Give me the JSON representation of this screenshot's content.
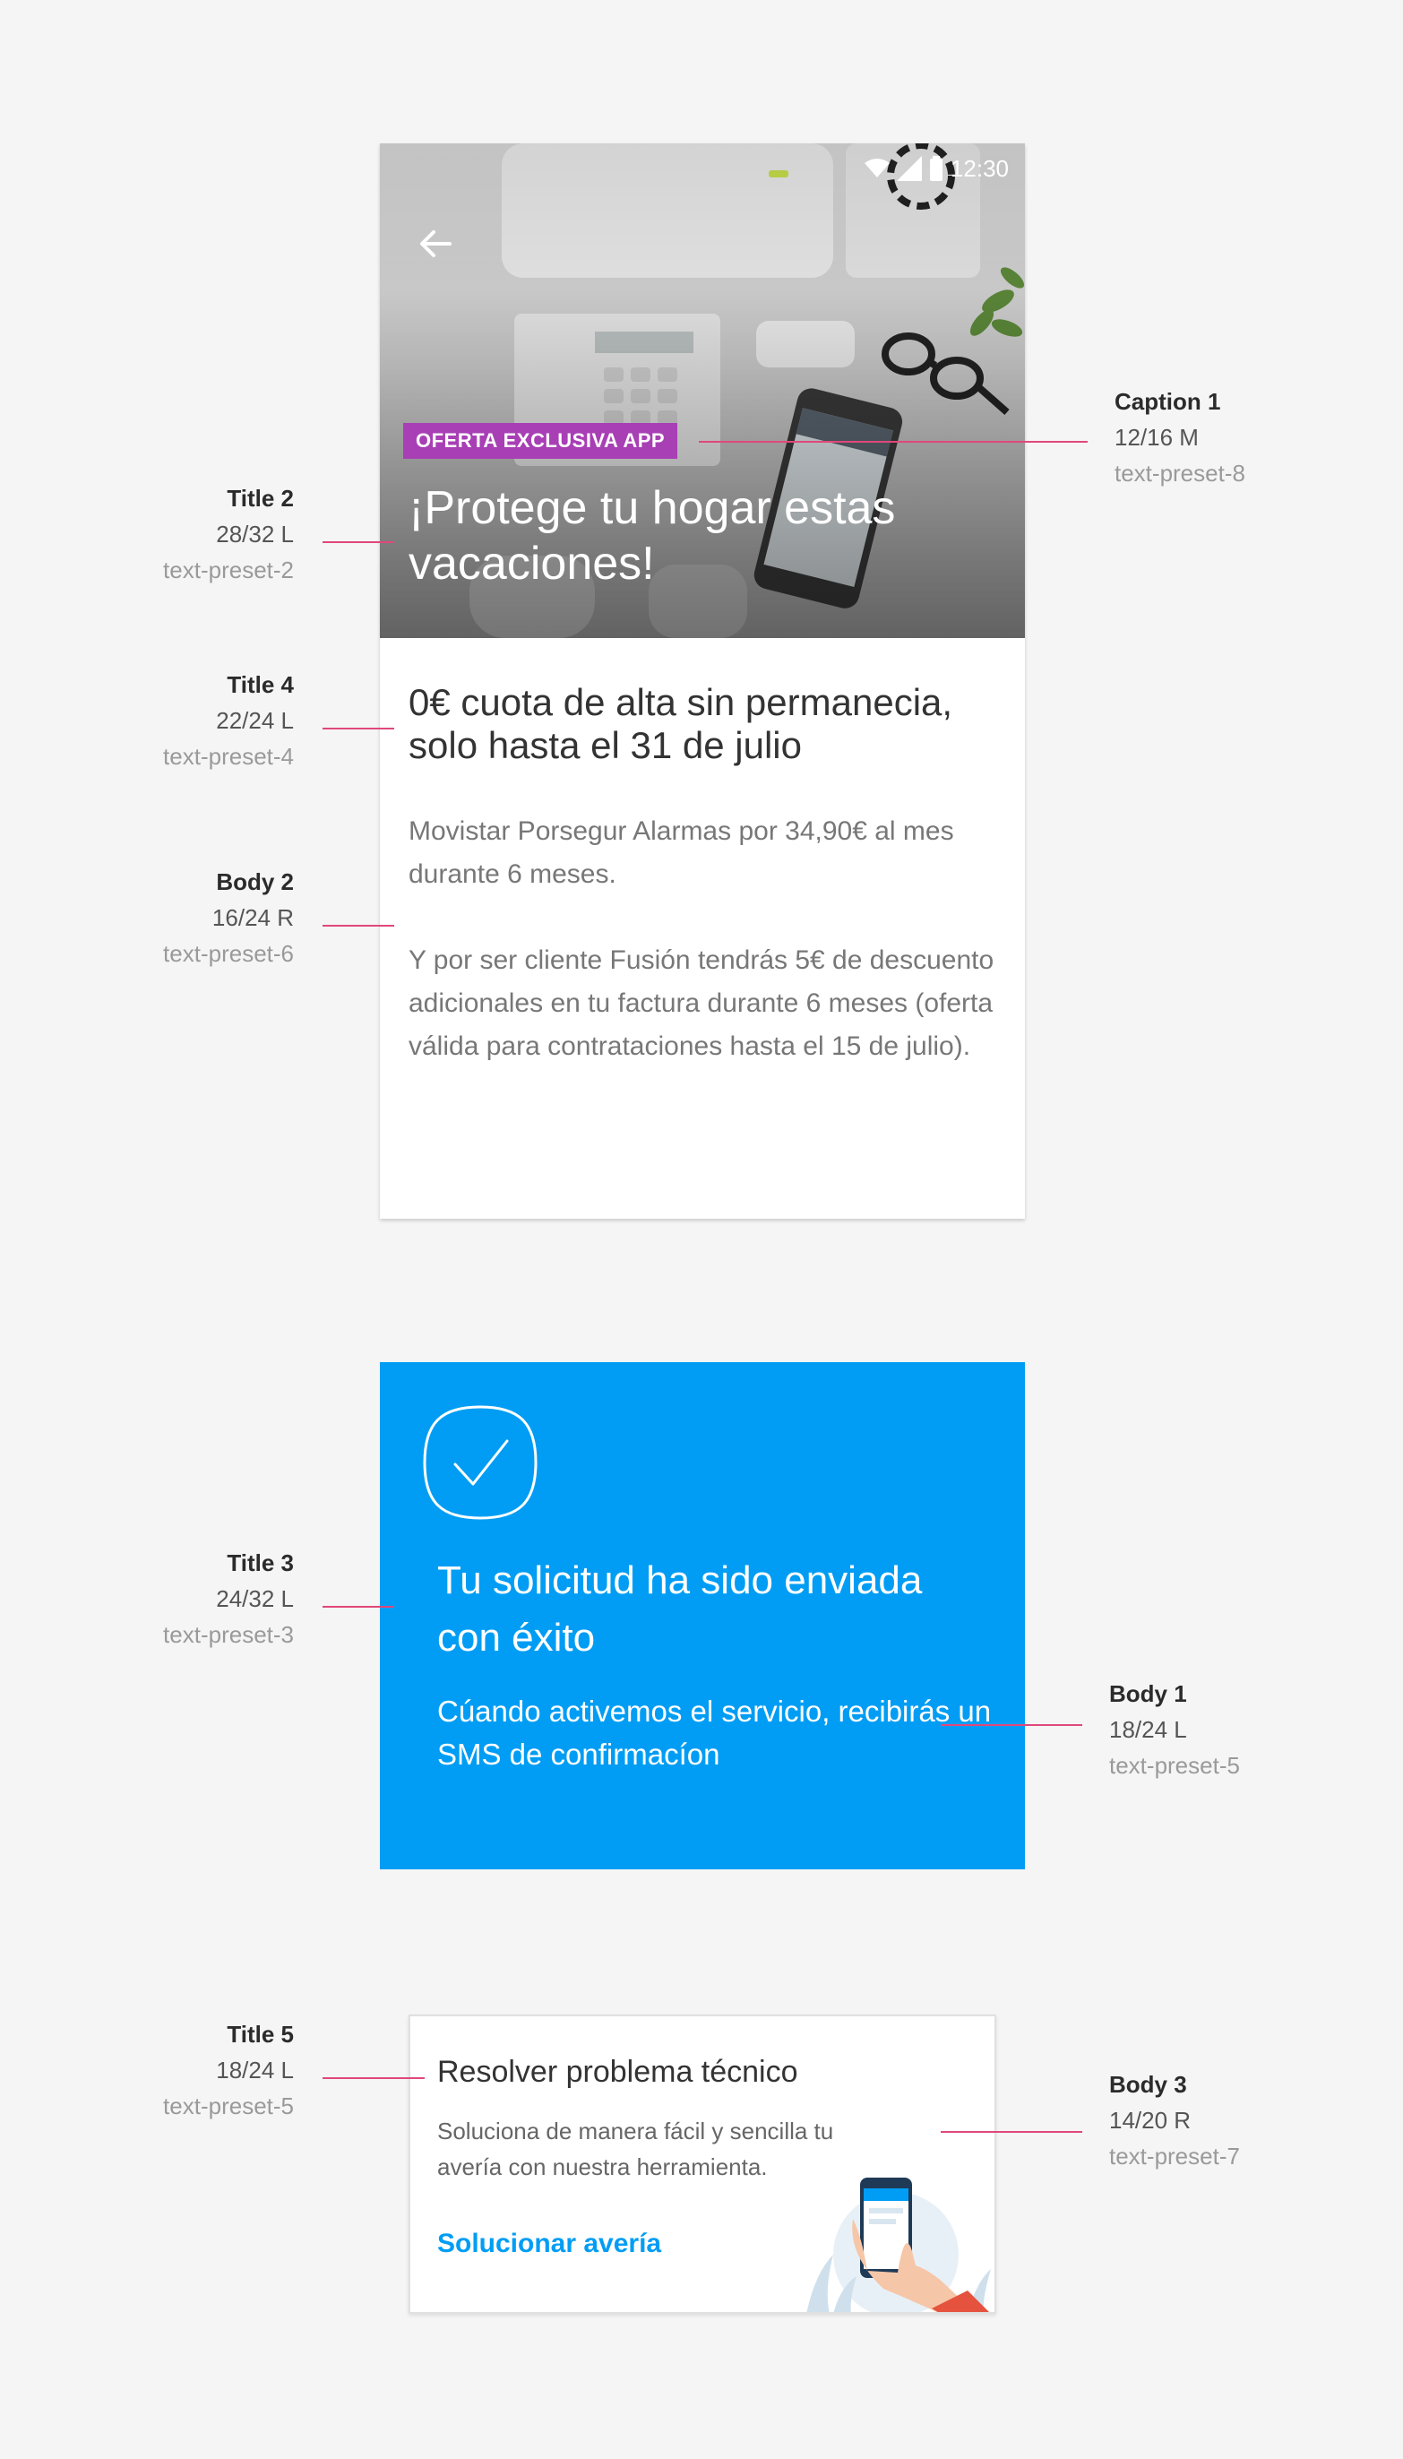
{
  "annotations": {
    "title2": {
      "name": "Title 2",
      "spec": "28/32 L",
      "token": "text-preset-2"
    },
    "caption1": {
      "name": "Caption 1",
      "spec": "12/16 M",
      "token": "text-preset-8"
    },
    "title4": {
      "name": "Title 4",
      "spec": "22/24 L",
      "token": "text-preset-4"
    },
    "body2": {
      "name": "Body 2",
      "spec": "16/24 R",
      "token": "text-preset-6"
    },
    "title3": {
      "name": "Title 3",
      "spec": "24/32 L",
      "token": "text-preset-3"
    },
    "body1": {
      "name": "Body 1",
      "spec": "18/24 L",
      "token": "text-preset-5"
    },
    "title5": {
      "name": "Title 5",
      "spec": "18/24 L",
      "token": "text-preset-5"
    },
    "body3": {
      "name": "Body 3",
      "spec": "14/20 R",
      "token": "text-preset-7"
    }
  },
  "offer_card": {
    "status_time": "12:30",
    "badge": "OFERTA EXCLUSIVA APP",
    "hero_title": "¡Protege tu hogar estas vacaciones!",
    "title": "0€ cuota de alta sin permanecia, solo hasta el 31 de julio",
    "body_1": "Movistar Porsegur Alarmas por 34,90€ al mes durante 6 meses.",
    "body_2": "Y por ser cliente Fusión tendrás 5€ de descuento adicionales en tu factura durante 6 meses (oferta válida para contrataciones hasta el 15 de julio).",
    "back_icon": "arrow-left-icon"
  },
  "success_card": {
    "icon": "check-icon",
    "title": "Tu solicitud ha sido enviada con éxito",
    "body": "Cúando activemos el servicio, recibirás un SMS de confirmacíon"
  },
  "tech_card": {
    "title": "Resolver problema técnico",
    "body": "Soluciona de manera fácil y sencilla tu avería con nuestra herramienta.",
    "link": "Solucionar avería"
  },
  "colors": {
    "accent_blue": "#019df4",
    "badge_purple": "#a83fb5",
    "leader_pink": "#e0487a"
  }
}
